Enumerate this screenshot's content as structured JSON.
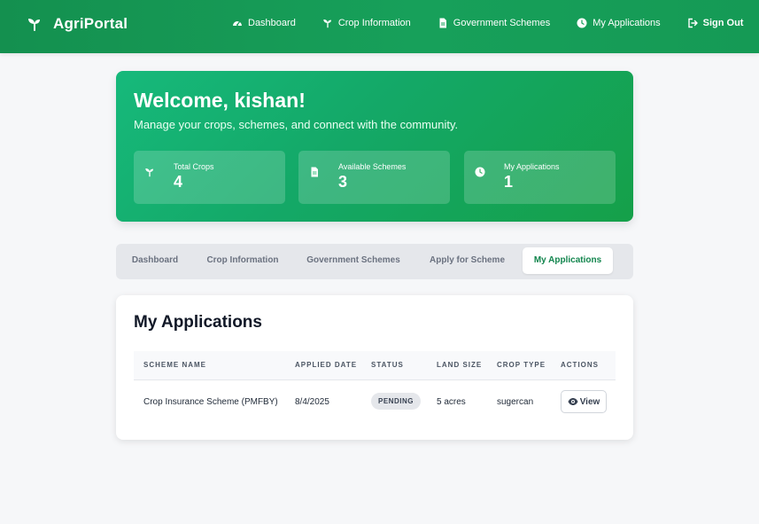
{
  "brand": {
    "name": "AgriPortal",
    "icon": "sprout-icon"
  },
  "nav": {
    "items": [
      {
        "label": "Dashboard",
        "icon": "gauge-icon"
      },
      {
        "label": "Crop Information",
        "icon": "sprout-icon"
      },
      {
        "label": "Government Schemes",
        "icon": "document-icon"
      },
      {
        "label": "My Applications",
        "icon": "clock-icon"
      },
      {
        "label": "Sign Out",
        "icon": "sign-out-icon"
      }
    ]
  },
  "hero": {
    "title": "Welcome, kishan!",
    "subtitle": "Manage your crops, schemes, and connect with the community.",
    "stats": [
      {
        "label": "Total Crops",
        "value": "4",
        "icon": "sprout-icon"
      },
      {
        "label": "Available Schemes",
        "value": "3",
        "icon": "document-icon"
      },
      {
        "label": "My Applications",
        "value": "1",
        "icon": "clock-icon"
      }
    ]
  },
  "tabs": [
    {
      "label": "Dashboard",
      "active": false
    },
    {
      "label": "Crop Information",
      "active": false
    },
    {
      "label": "Government Schemes",
      "active": false
    },
    {
      "label": "Apply for Scheme",
      "active": false
    },
    {
      "label": "My Applications",
      "active": true
    }
  ],
  "applications": {
    "title": "My Applications",
    "columns": [
      "SCHEME NAME",
      "APPLIED DATE",
      "STATUS",
      "LAND SIZE",
      "CROP TYPE",
      "ACTIONS"
    ],
    "rows": [
      {
        "scheme_name": "Crop Insurance Scheme (PMFBY)",
        "applied_date": "8/4/2025",
        "status": "PENDING",
        "land_size": "5 acres",
        "crop_type": "sugercan",
        "action_label": "View",
        "action_icon": "eye-icon"
      }
    ]
  },
  "colors": {
    "primary": "#16a05a",
    "accent_text": "#12854d",
    "badge_bg": "#e5e7eb",
    "page_bg": "#f6f7f9"
  }
}
